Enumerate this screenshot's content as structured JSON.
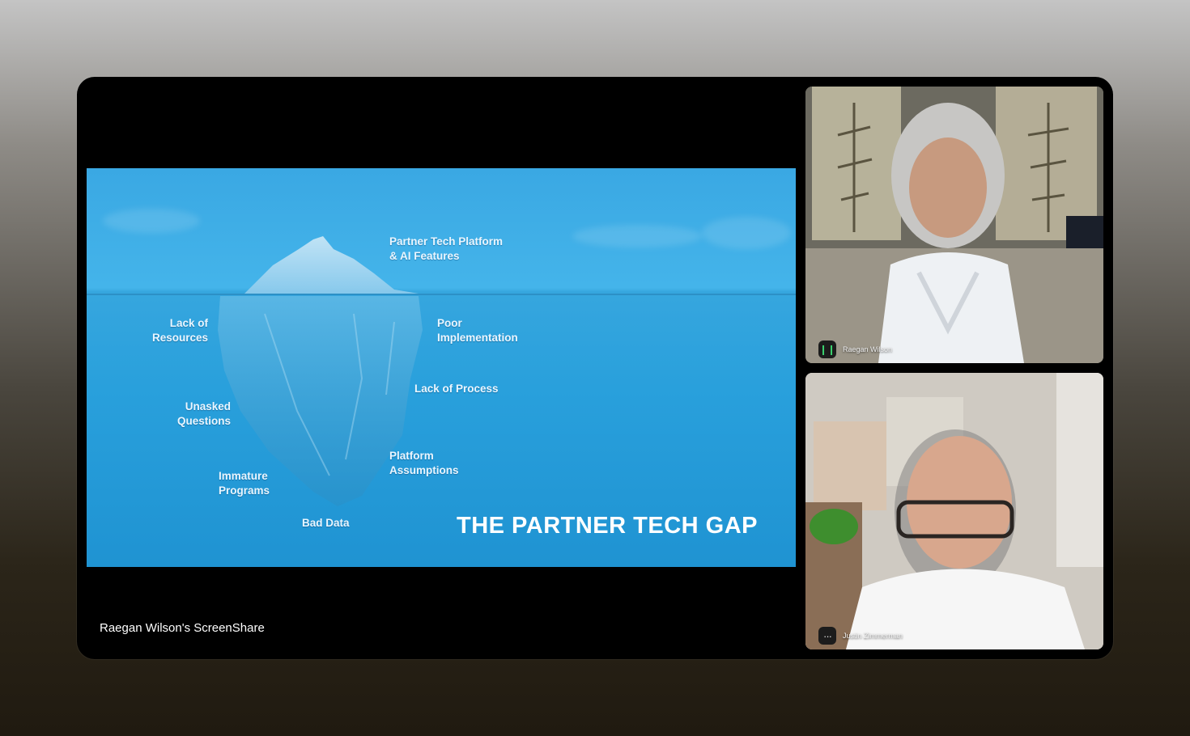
{
  "screenshare": {
    "caption": "Raegan Wilson's ScreenShare",
    "slide": {
      "title": "THE PARTNER TECH GAP",
      "labels": {
        "top_1": "Partner Tech Platform",
        "top_2": "& AI Features",
        "lack_resources_1": "Lack of",
        "lack_resources_2": "Resources",
        "poor_impl_1": "Poor",
        "poor_impl_2": "Implementation",
        "lack_process": "Lack of Process",
        "unasked_1": "Unasked",
        "unasked_2": "Questions",
        "platform_assump_1": "Platform",
        "platform_assump_2": "Assumptions",
        "immature_1": "Immature",
        "immature_2": "Programs",
        "bad_data": "Bad Data"
      }
    }
  },
  "participants": [
    {
      "name": "Raegan Wilson",
      "mic_icon": "mic-active-icon"
    },
    {
      "name": "Justin Zimmerman",
      "mic_icon": "more-options-icon",
      "mic_glyph": "···"
    }
  ],
  "colors": {
    "slide_blue": "#2ea3de",
    "mic_active": "#3bd16f",
    "frame": "#000000"
  }
}
